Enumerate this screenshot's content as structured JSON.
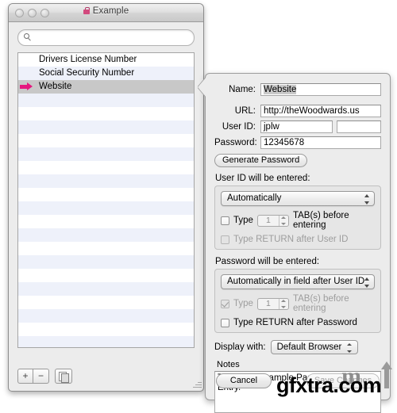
{
  "window": {
    "title": "Example",
    "title_icon": "lock-icon",
    "traffic_lights": [
      "close",
      "minimize",
      "zoom"
    ]
  },
  "search": {
    "value": "",
    "placeholder": "",
    "icon": "search-icon"
  },
  "list": {
    "items": [
      {
        "label": "Drivers License Number",
        "selected": false,
        "marked": false
      },
      {
        "label": "Social Security Number",
        "selected": false,
        "marked": false
      },
      {
        "label": "Website",
        "selected": true,
        "marked": true
      }
    ],
    "empty_rows": 19,
    "marker_color": "#e5187f",
    "selected_row_color": "#c8c8c8",
    "stripe_color": "#eef1fa"
  },
  "toolbar": {
    "add_label": "+",
    "remove_label": "−",
    "duplicate_label": "duplicate-icon"
  },
  "detail": {
    "name_label": "Name:",
    "name_value": "Website",
    "url_label": "URL:",
    "url_value": "http://theWoodwards.us",
    "userid_label": "User ID:",
    "userid_value": "jplw",
    "userid_extra_value": "",
    "password_label": "Password:",
    "password_value": "12345678",
    "generate_password_label": "Generate Password",
    "userid_section_title": "User ID will be entered:",
    "userid_mode": "Automatically",
    "userid_tab_label_a": "Type",
    "userid_tab_count": "1",
    "userid_tab_label_b": "TAB(s) before entering",
    "userid_tab_checked": false,
    "userid_return_label": "Type RETURN after User ID",
    "userid_return_checked": false,
    "userid_return_disabled": true,
    "password_section_title": "Password will be entered:",
    "password_mode": "Automatically in field after User ID",
    "password_tab_label_a": "Type",
    "password_tab_count": "1",
    "password_tab_label_b": "TAB(s) before entering",
    "password_tab_checked": true,
    "password_tab_disabled": true,
    "password_return_label": "Type RETURN after Password",
    "password_return_checked": false,
    "display_with_label": "Display with:",
    "display_with_value": "Default Browser",
    "notes_label": "Notes",
    "notes_value": "This is an example Password Master Entry.",
    "cancel_label": "Cancel",
    "save_label": "Save Changes",
    "save_disabled": true
  },
  "watermark": {
    "text": "gfxtra.com",
    "logo": "m"
  }
}
